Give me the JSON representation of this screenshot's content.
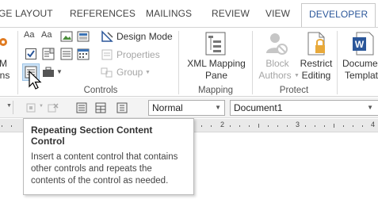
{
  "tabs": [
    {
      "label": "GE LAYOUT"
    },
    {
      "label": "REFERENCES"
    },
    {
      "label": "MAILINGS"
    },
    {
      "label": "REVIEW"
    },
    {
      "label": "VIEW"
    },
    {
      "label": "DEVELOPER",
      "active": true
    }
  ],
  "ribbon": {
    "left_partial": [
      "M",
      "ins"
    ],
    "controls": {
      "design_mode": "Design Mode",
      "properties": "Properties",
      "group": "Group",
      "label": "Controls"
    },
    "mapping": {
      "xml_pane_line1": "XML Mapping",
      "xml_pane_line2": "Pane",
      "label": "Mapping"
    },
    "protect": {
      "block_line1": "Block",
      "block_line2": "Authors",
      "restrict_line1": "Restrict",
      "restrict_line2": "Editing",
      "label": "Protect"
    },
    "templates": {
      "doc_line1": "Docume",
      "doc_line2": "Templat"
    }
  },
  "toolbar2": {
    "style_value": "Normal",
    "document_value": "Document1"
  },
  "ruler": {
    "numbers": [
      "2",
      "3",
      "4"
    ]
  },
  "tooltip": {
    "title": "Repeating Section Content Control",
    "body": "Insert a content control that contains other controls and repeats the contents of the control as needed."
  },
  "colors": {
    "accent": "#2b579a",
    "word_blue": "#2b579a",
    "lock_gold": "#e8a93a"
  }
}
